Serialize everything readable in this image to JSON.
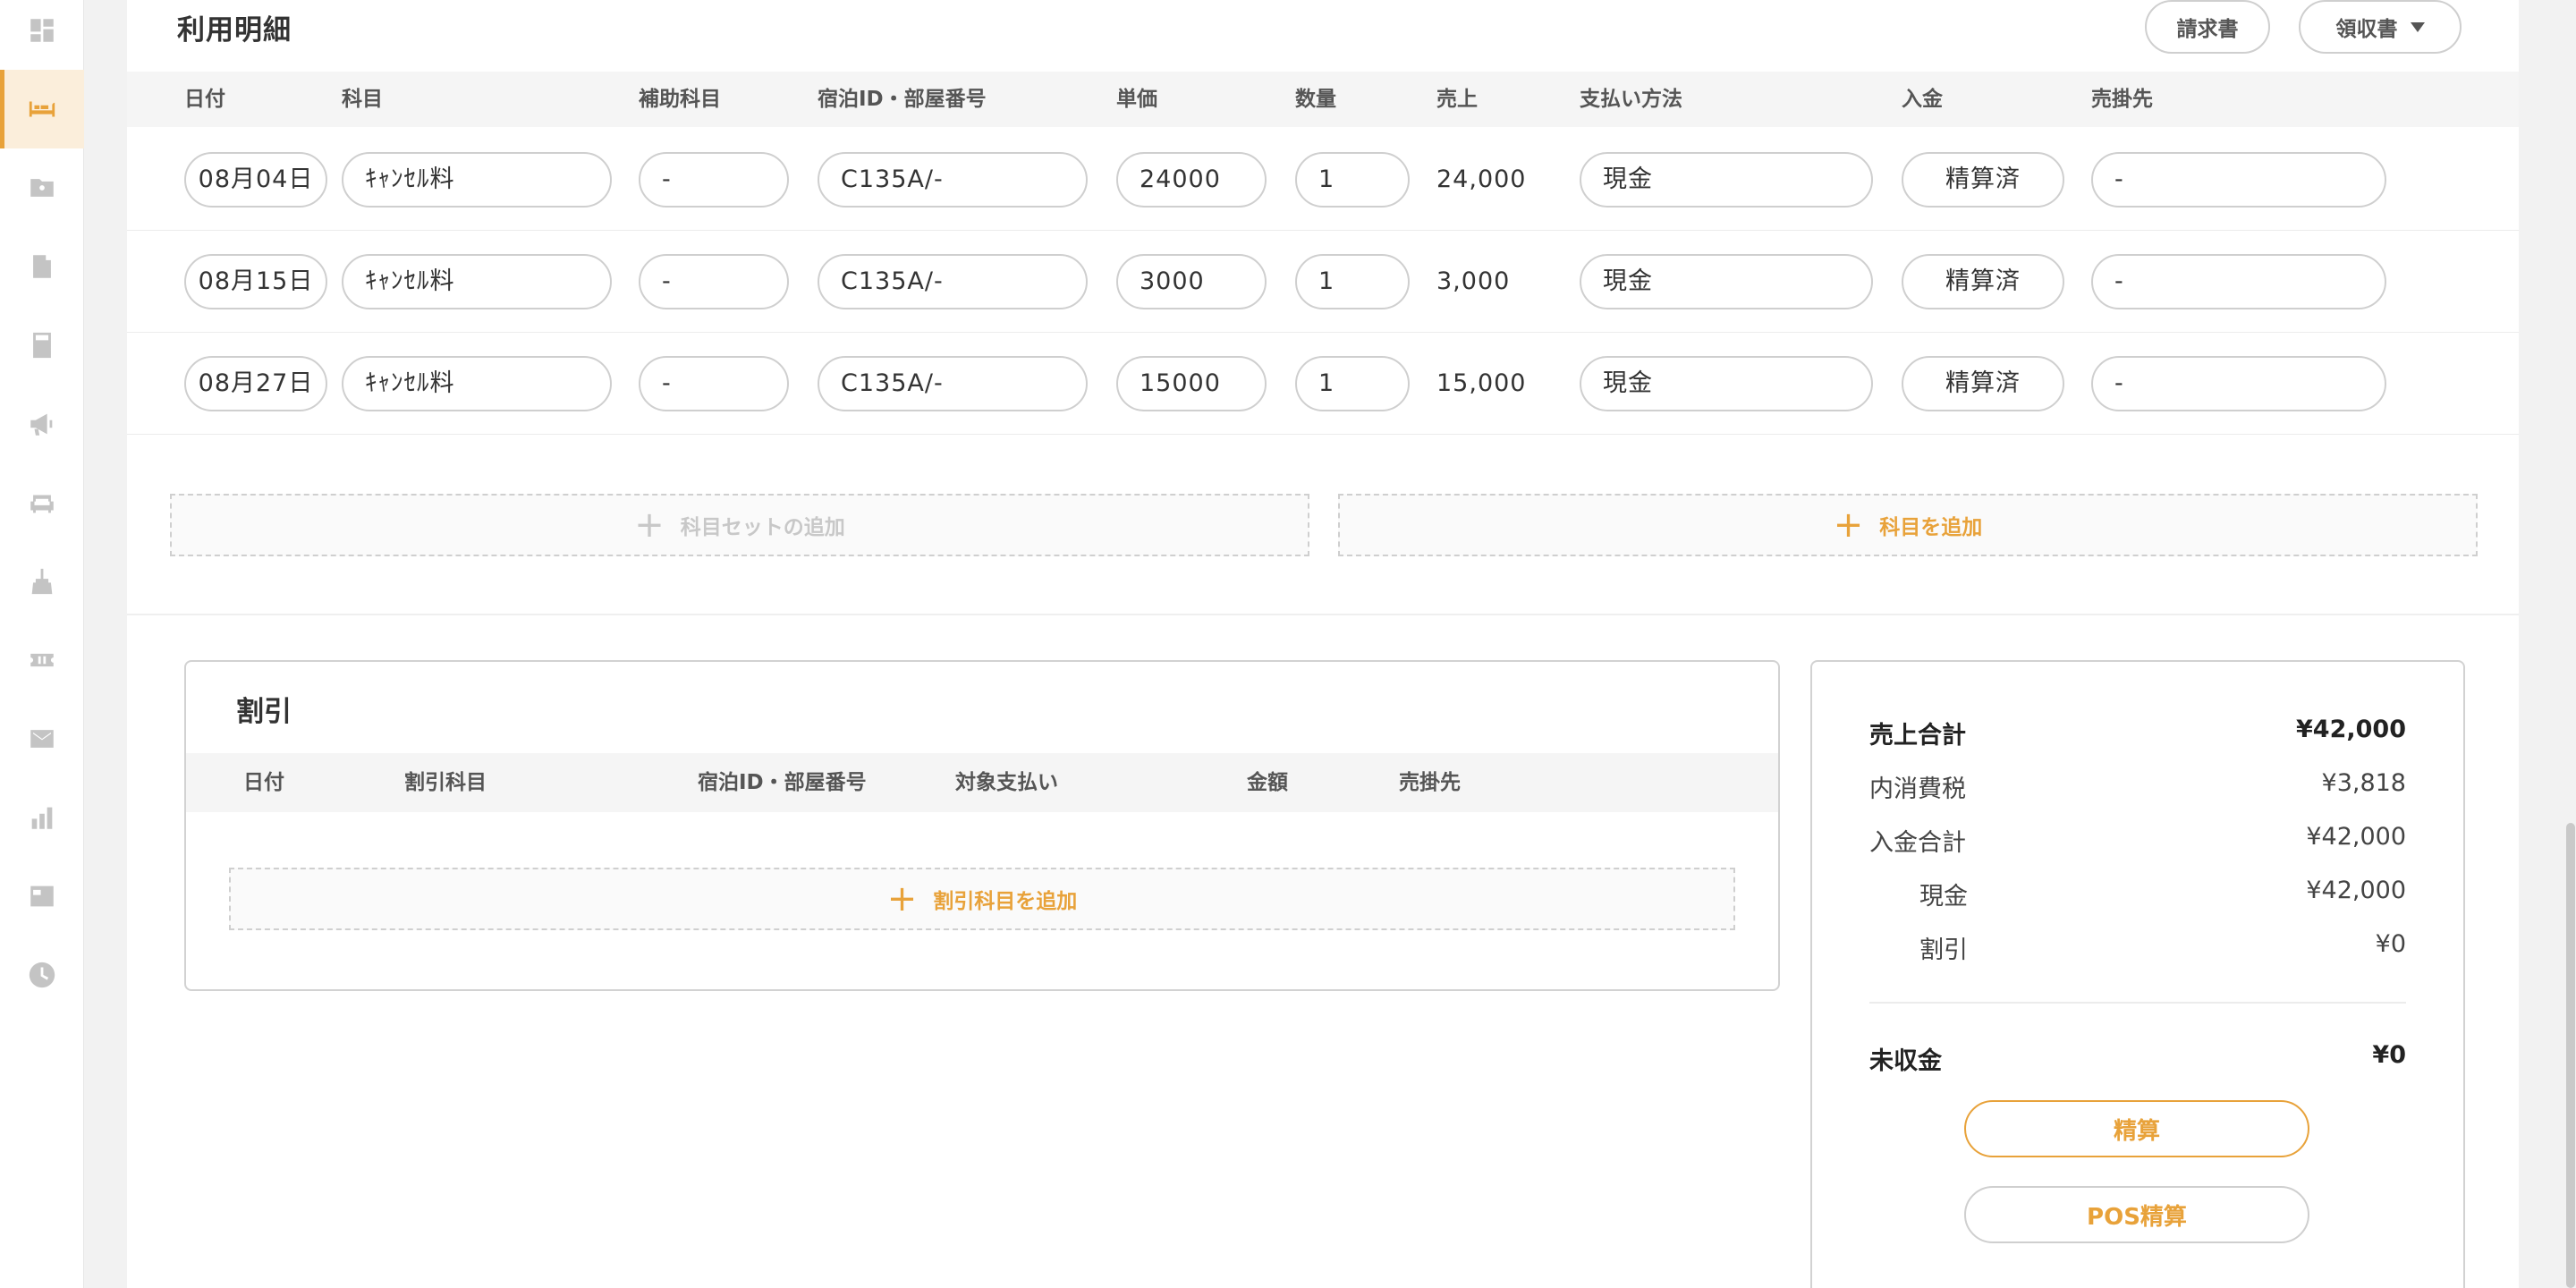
{
  "section": {
    "title": "利用明細",
    "invoice_button": "請求書",
    "receipt_button": "領収書"
  },
  "columns": {
    "date": "日付",
    "item": "科目",
    "sub_item": "補助科目",
    "stay": "宿泊ID・部屋番号",
    "unit_price": "単価",
    "quantity": "数量",
    "sales": "売上",
    "payment": "支払い方法",
    "deposit": "入金",
    "receivable": "売掛先"
  },
  "rows": [
    {
      "date": "08月04日",
      "item": "ｷｬﾝｾﾙ料",
      "sub_item": "-",
      "stay": "C135A/-",
      "unit_price": "24000",
      "quantity": "1",
      "sales": "24,000",
      "payment": "現金",
      "deposit": "精算済",
      "receivable": "-"
    },
    {
      "date": "08月15日",
      "item": "ｷｬﾝｾﾙ料",
      "sub_item": "-",
      "stay": "C135A/-",
      "unit_price": "3000",
      "quantity": "1",
      "sales": "3,000",
      "payment": "現金",
      "deposit": "精算済",
      "receivable": "-"
    },
    {
      "date": "08月27日",
      "item": "ｷｬﾝｾﾙ料",
      "sub_item": "-",
      "stay": "C135A/-",
      "unit_price": "15000",
      "quantity": "1",
      "sales": "15,000",
      "payment": "現金",
      "deposit": "精算済",
      "receivable": "-"
    }
  ],
  "actions": {
    "plus": "+",
    "add_item_set": "科目セットの追加",
    "add_item": "科目を追加"
  },
  "discount": {
    "title": "割引",
    "columns": {
      "date": "日付",
      "discount_item": "割引科目",
      "stay": "宿泊ID・部屋番号",
      "target_payment": "対象支払い",
      "amount": "金額",
      "receivable": "売掛先"
    },
    "add_label": "割引科目を追加"
  },
  "totals": {
    "sales_total_label": "売上合計",
    "sales_total_value": "¥42,000",
    "tax_label": "内消費税",
    "tax_value": "¥3,818",
    "deposit_total_label": "入金合計",
    "deposit_total_value": "¥42,000",
    "cash_label": "現金",
    "cash_value": "¥42,000",
    "discount_label": "割引",
    "discount_value": "¥0",
    "unpaid_label": "未収金",
    "unpaid_value": "¥0",
    "settle_button": "精算",
    "pos_settle_button": "POS精算"
  },
  "sidebar": {
    "icons": [
      "dashboard-icon",
      "bed-icon",
      "guest-folder-icon",
      "building-icon",
      "calculator-icon",
      "megaphone-icon",
      "sofa-icon",
      "cleaning-icon",
      "ticket-icon",
      "mail-icon",
      "bar-chart-icon",
      "news-icon",
      "clock-icon"
    ],
    "active_index": 1
  },
  "colors": {
    "accent": "#e8a23a",
    "border": "#cfcfcf",
    "header_bg": "#f5f5f5"
  }
}
